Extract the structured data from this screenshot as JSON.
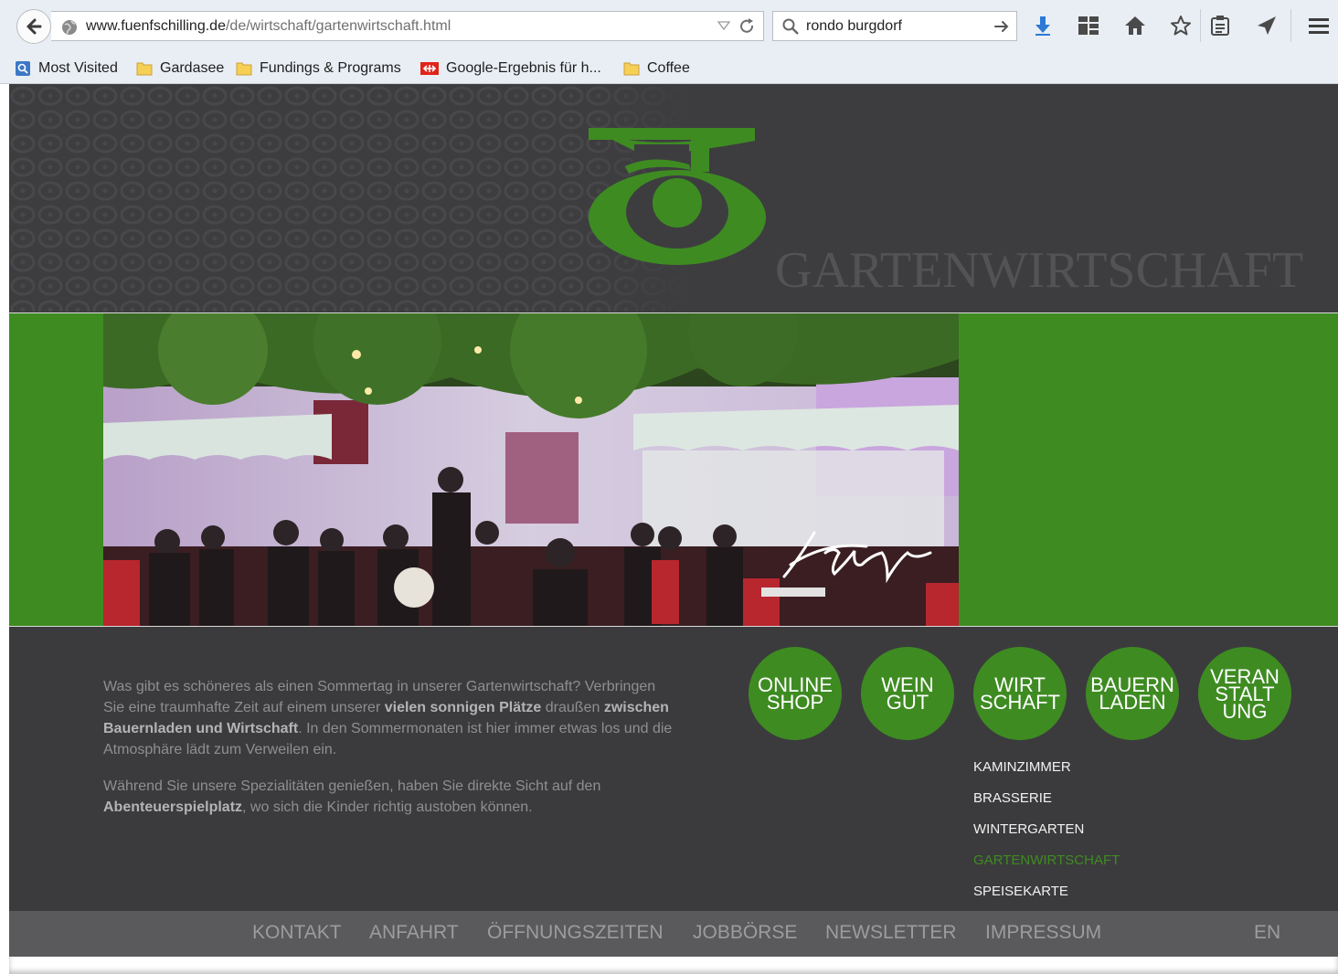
{
  "browser": {
    "url_host": "www.fuenfschilling.de",
    "url_path": "/de/wirtschaft/gartenwirtschaft.html",
    "search_query": "rondo burgdorf",
    "bookmarks": [
      "Most Visited",
      "Gardasee",
      "Fundings & Programs",
      "Google-Ergebnis für h...",
      "Coffee"
    ]
  },
  "site": {
    "page_heading": "GARTENWIRTSCHAFT",
    "hero_signature": "Fischingen",
    "intro": {
      "p1_a": "Was gibt es schöneres als einen Sommertag in unserer Gartenwirtschaft? Verbringen Sie eine traumhafte Zeit auf einem unserer ",
      "p1_b": "vielen sonnigen Plätze",
      "p1_c": " draußen ",
      "p1_d": "zwischen Bauernladen und Wirtschaft",
      "p1_e": ". In den Sommermonaten ist hier immer etwas los und die Atmosphäre lädt zum Verweilen ein.",
      "p2_a": "Während Sie unsere Spezialitäten genießen, haben Sie direkte Sicht auf den ",
      "p2_b": "Abenteuerspielplatz",
      "p2_c": ", wo sich die Kinder richtig austoben können."
    },
    "circle_nav": [
      {
        "label": "ONLINE\nSHOP"
      },
      {
        "label": "WEIN\nGUT"
      },
      {
        "label": "WIRT\nSCHAFT"
      },
      {
        "label": "BAUERN\nLADEN"
      },
      {
        "label": "VERAN\nSTALT\nUNG"
      }
    ],
    "submenu": [
      "KAMINZIMMER",
      "BRASSERIE",
      "WINTERGARTEN",
      "GARTENWIRTSCHAFT",
      "SPEISEKARTE"
    ],
    "submenu_active": "GARTENWIRTSCHAFT",
    "footer": [
      "KONTAKT",
      "ANFAHRT",
      "ÖFFNUNGSZEITEN",
      "JOBBÖRSE",
      "NEWSLETTER",
      "IMPRESSUM"
    ],
    "footer_lang": "EN"
  },
  "colors": {
    "brand_green": "#3e8b22",
    "dark_bg": "#3b3b3d",
    "footer_bg": "#5a5a5c"
  }
}
